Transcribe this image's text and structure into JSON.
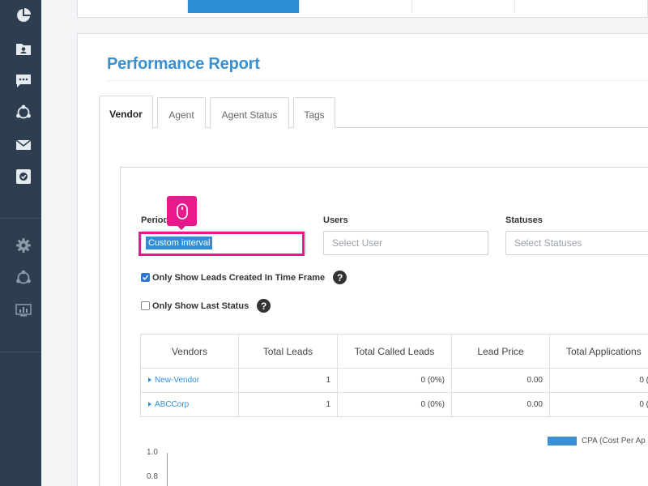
{
  "sidebar": {
    "items": [
      {
        "icon": "pie-chart-icon"
      },
      {
        "icon": "contacts-folder-icon"
      },
      {
        "icon": "chat-icon"
      },
      {
        "icon": "share-icon"
      },
      {
        "icon": "mail-icon"
      },
      {
        "icon": "checklist-icon"
      },
      {
        "icon": "gear-icon"
      },
      {
        "icon": "share-icon"
      },
      {
        "icon": "monitor-chart-icon"
      }
    ]
  },
  "page": {
    "title": "Performance Report"
  },
  "tabs": [
    {
      "label": "Vendor",
      "active": true
    },
    {
      "label": "Agent",
      "active": false
    },
    {
      "label": "Agent Status",
      "active": false
    },
    {
      "label": "Tags",
      "active": false
    }
  ],
  "filters": {
    "period_label": "Period",
    "period_value": "Custom interval",
    "users_label": "Users",
    "users_placeholder": "Select User",
    "statuses_label": "Statuses",
    "statuses_placeholder": "Select Statuses"
  },
  "options": {
    "created_in_time_frame": {
      "label": "Only Show Leads Created In Time Frame",
      "checked": true
    },
    "last_status": {
      "label": "Only Show Last Status",
      "checked": false
    }
  },
  "table": {
    "headers": [
      "Vendors",
      "Total Leads",
      "Total Called Leads",
      "Lead Price",
      "Total Applications"
    ],
    "rows": [
      {
        "vendor": "New-Vendor",
        "total_leads": "1",
        "total_called": "0 (0%)",
        "lead_price": "0.00",
        "applications": "0 ("
      },
      {
        "vendor": "ABCCorp",
        "total_leads": "1",
        "total_called": "0 (0%)",
        "lead_price": "0.00",
        "applications": "0 ("
      }
    ]
  },
  "chart": {
    "legend": "CPA (Cost Per Ap",
    "yticks": [
      "1.0",
      "0.8"
    ]
  },
  "colors": {
    "accent": "#2e8fd8",
    "sidebar": "#2d3e50",
    "highlight": "#e8198b"
  }
}
